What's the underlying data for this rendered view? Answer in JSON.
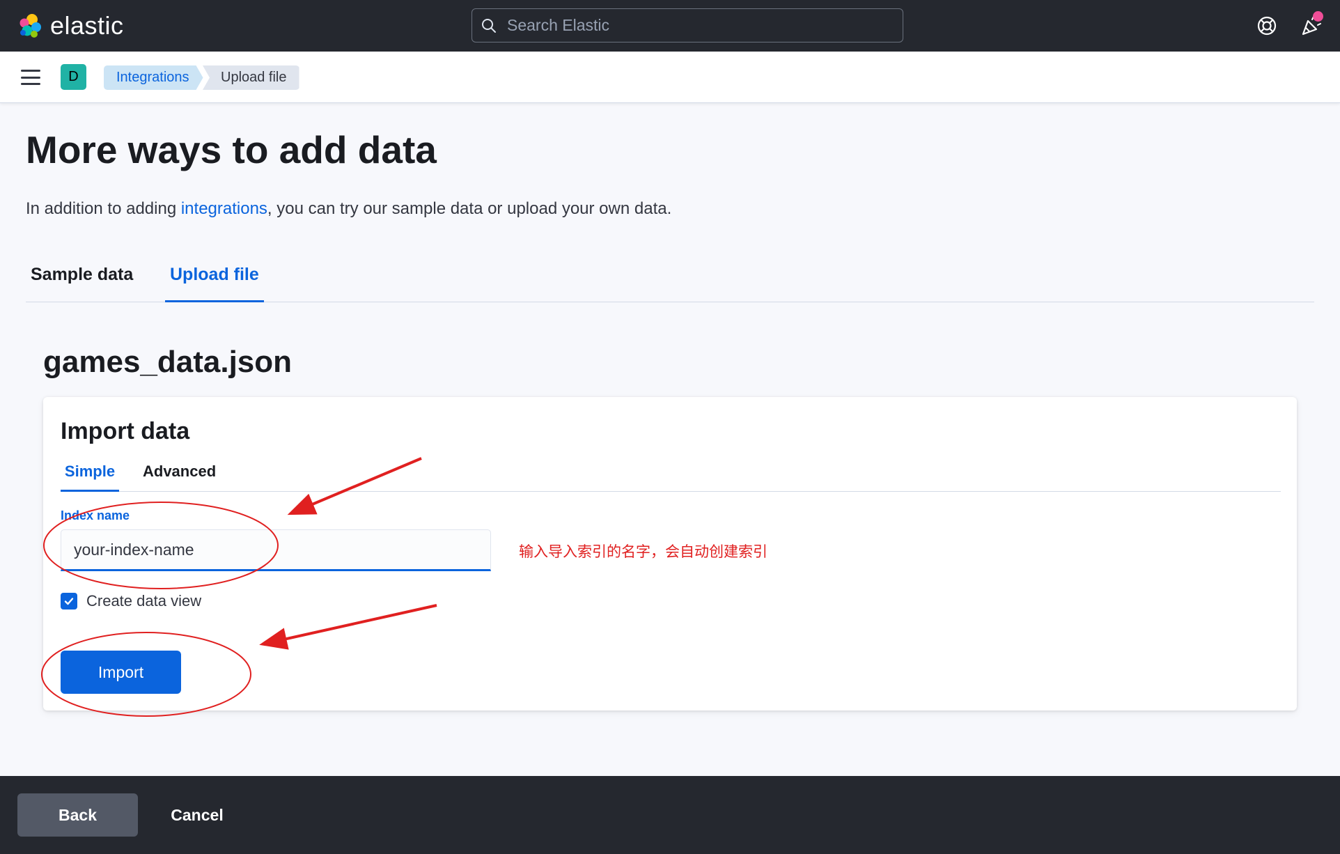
{
  "header": {
    "brand": "elastic",
    "search_placeholder": "Search Elastic",
    "icons": [
      "elastic-logo-icon",
      "search-icon",
      "help-icon",
      "news-feed-icon"
    ],
    "notification_color": "#f04e98"
  },
  "subheader": {
    "space_initial": "D",
    "breadcrumbs": [
      "Integrations",
      "Upload file"
    ]
  },
  "main": {
    "title": "More ways to add data",
    "intro_before": "In addition to adding ",
    "intro_link": "integrations",
    "intro_after": ", you can try our sample data or upload your own data.",
    "tabs": [
      {
        "label": "Sample data",
        "active": false
      },
      {
        "label": "Upload file",
        "active": true
      }
    ],
    "file_name": "games_data.json",
    "panel": {
      "title": "Import data",
      "tabs": [
        {
          "label": "Simple",
          "active": true
        },
        {
          "label": "Advanced",
          "active": false
        }
      ],
      "index_label": "Index name",
      "index_value": "your-index-name",
      "create_view_label": "Create data view",
      "create_view_checked": true,
      "import_label": "Import"
    }
  },
  "annotation": {
    "note": "输入导入索引的名字，会自动创建索引",
    "color": "#e02020"
  },
  "footer": {
    "back_label": "Back",
    "cancel_label": "Cancel"
  },
  "colors": {
    "accent": "#0b64dd",
    "header_bg": "#25282f"
  }
}
